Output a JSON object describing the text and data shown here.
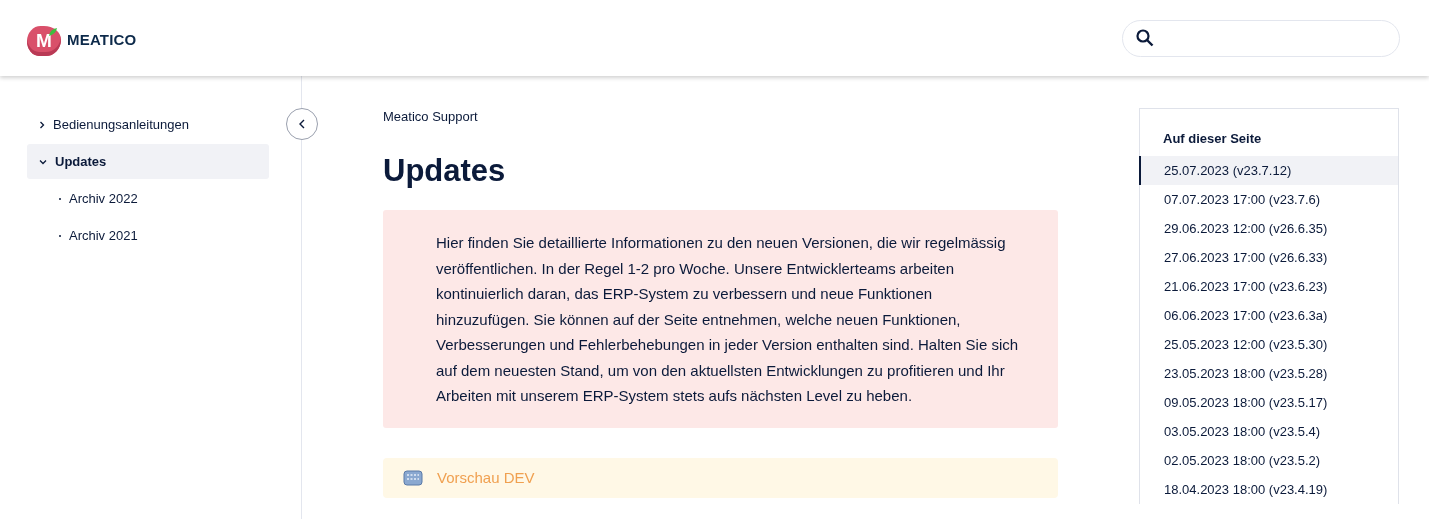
{
  "header": {
    "logo_mark": "M",
    "logo_text": "MEATICO"
  },
  "sidebar": {
    "items": [
      {
        "label": "Bedienungsanleitungen",
        "expanded": false,
        "selected": false
      },
      {
        "label": "Updates",
        "expanded": true,
        "selected": true,
        "children": [
          {
            "label": "Archiv 2022",
            "selected": false
          },
          {
            "label": "Archiv 2021",
            "selected": false
          }
        ]
      }
    ]
  },
  "main": {
    "breadcrumb": "Meatico Support",
    "title": "Updates",
    "intro": "Hier finden Sie detaillierte Informationen zu den neuen Versionen, die wir regelmässig veröffentlichen. In der Regel 1-2 pro Woche. Unsere Entwicklerteams arbeiten kontinuierlich daran, das ERP-System zu verbessern und neue Funktionen hinzuzufügen. Sie können auf der Seite entnehmen, welche neuen Funktionen, Verbesserungen und Fehlerbehebungen in jeder Version enthalten sind. Halten Sie sich auf dem neuesten Stand, um von den aktuellsten Entwicklungen zu profitieren und Ihr Arbeiten mit unserem ERP-System stets aufs nächsten Level zu heben.",
    "notice": {
      "title": "Vorschau DEV"
    }
  },
  "toc": {
    "title": "Auf dieser Seite",
    "items": [
      {
        "label": "25.07.2023 (v23.7.12)",
        "selected": true
      },
      {
        "label": "07.07.2023 17:00 (v23.7.6)",
        "selected": false
      },
      {
        "label": "29.06.2023 12:00 (v26.6.35)",
        "selected": false
      },
      {
        "label": "27.06.2023 17:00 (v26.6.33)",
        "selected": false
      },
      {
        "label": "21.06.2023 17:00 (v23.6.23)",
        "selected": false
      },
      {
        "label": "06.06.2023 17:00 (v23.6.3a)",
        "selected": false
      },
      {
        "label": "25.05.2023 12:00 (v23.5.30)",
        "selected": false
      },
      {
        "label": "23.05.2023 18:00 (v23.5.28)",
        "selected": false
      },
      {
        "label": "09.05.2023 18:00 (v23.5.17)",
        "selected": false
      },
      {
        "label": "03.05.2023 18:00 (v23.5.4)",
        "selected": false
      },
      {
        "label": "02.05.2023 18:00 (v23.5.2)",
        "selected": false
      },
      {
        "label": "18.04.2023 18:00 (v23.4.19)",
        "selected": false
      }
    ]
  }
}
